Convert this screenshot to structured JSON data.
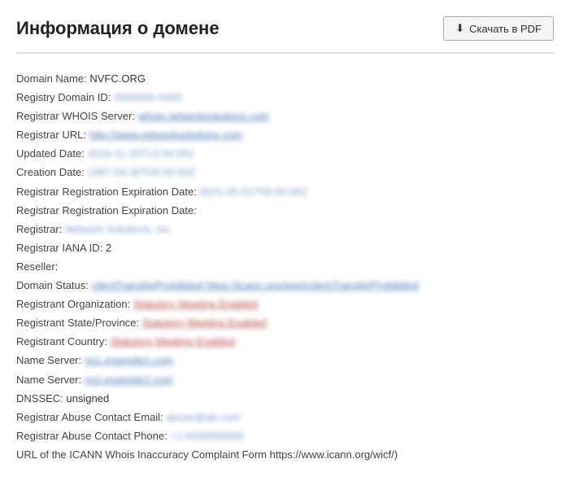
{
  "header": {
    "title": "Информация о домене",
    "pdf_button_label": "Скачать в PDF"
  },
  "whois": {
    "rows": [
      {
        "label": "Domain Name:",
        "value": "NVFC.ORG",
        "type": "plain-bold"
      },
      {
        "label": "Registry Domain ID:",
        "value": "0000000-0000",
        "type": "blur"
      },
      {
        "label": "Registrar WHOIS Server:",
        "value": "whois.networksolutions.com",
        "type": "link"
      },
      {
        "label": "Registrar URL:",
        "value": "http://www.networksolutions.com",
        "type": "link"
      },
      {
        "label": "Updated Date:",
        "value": "2019-11-20T13:54:002",
        "type": "blur"
      },
      {
        "label": "Creation Date:",
        "value": "1997-04-30T04:00:00Z",
        "type": "blur"
      },
      {
        "label": "Registrar Registration Expiration Date:",
        "value": "2021-05-01T00:00:00Z",
        "type": "blur"
      },
      {
        "label": "Registrar Registration Expiration Date:",
        "value": "",
        "type": "empty"
      },
      {
        "label": "Registrar:",
        "value": "Network Solutions, Inc",
        "type": "blur"
      },
      {
        "label": "Registrar IANA ID:",
        "value": "2",
        "type": "plain"
      },
      {
        "label": "Reseller:",
        "value": "",
        "type": "empty"
      },
      {
        "label": "Domain Status:",
        "value": "clientTransferProhibited https://icann.org/epp#clientTransferProhibited",
        "type": "link"
      },
      {
        "label": "Registrant Organization:",
        "value": "Statutory Meeting Enabled",
        "type": "link-red"
      },
      {
        "label": "Registrant State/Province:",
        "value": "Statutory Meeting Enabled",
        "type": "link-red"
      },
      {
        "label": "Registrant Country:",
        "value": "Statutory Meeting Enabled",
        "type": "link-red"
      },
      {
        "label": "Name Server:",
        "value": "ns1.example1.com",
        "type": "link"
      },
      {
        "label": "Name Server:",
        "value": "ns2.example2.com",
        "type": "link"
      },
      {
        "label": "DNSSEC:",
        "value": "unsigned",
        "type": "plain"
      },
      {
        "label": "Registrar Abuse Contact Email:",
        "value": "abuse@ab.com",
        "type": "blur"
      },
      {
        "label": "Registrar Abuse Contact Phone:",
        "value": "+1.0000000000",
        "type": "blur"
      },
      {
        "label": "URL of the ICANN Whois Inaccuracy Complaint Form https://www.icann.org/wicf/)",
        "value": "",
        "type": "label-only"
      }
    ]
  }
}
